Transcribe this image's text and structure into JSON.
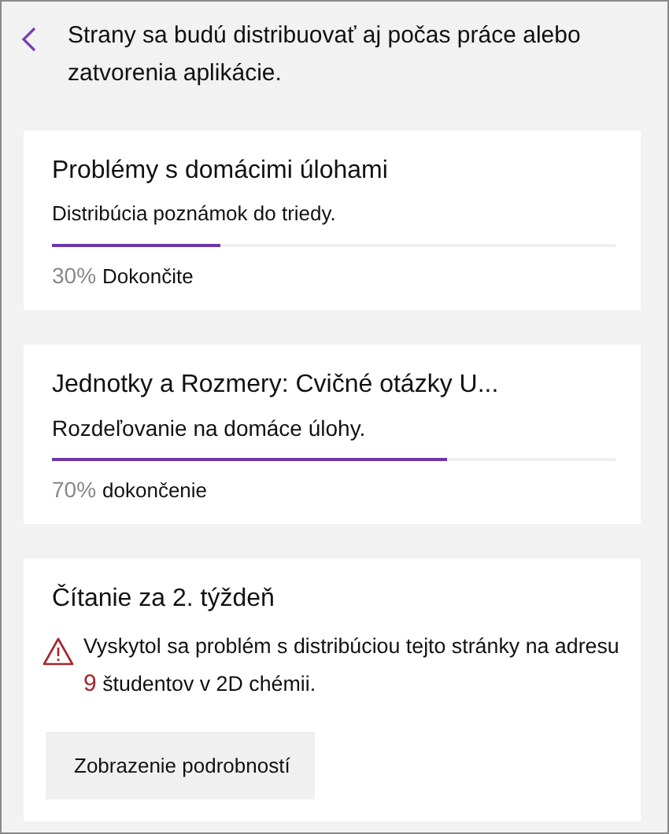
{
  "header": {
    "message": "Strany sa budú distribuovať aj počas práce alebo zatvorenia aplikácie."
  },
  "cards": [
    {
      "kind": "progress",
      "title": "Problémy s domácimi úlohami",
      "subtitle": "Distribúcia poznámok do triedy.",
      "level": 0.3,
      "percent": "30%",
      "status": "Dokončite"
    },
    {
      "kind": "progress",
      "title": "Jednotky a  Rozmery: Cvičné otázky U...",
      "subtitle": "Rozdeľovanie na domáce úlohy.",
      "level": 0.7,
      "percent": "70%",
      "status": "dokončenie"
    },
    {
      "kind": "error",
      "title": "Čítanie za 2. týždeň",
      "message": "Vyskytol sa problém s distribúciou tejto stránky na adresu",
      "count": "9",
      "message_end": "študentov v 2D chémii.",
      "button": "Zobrazenie podrobností"
    }
  ]
}
